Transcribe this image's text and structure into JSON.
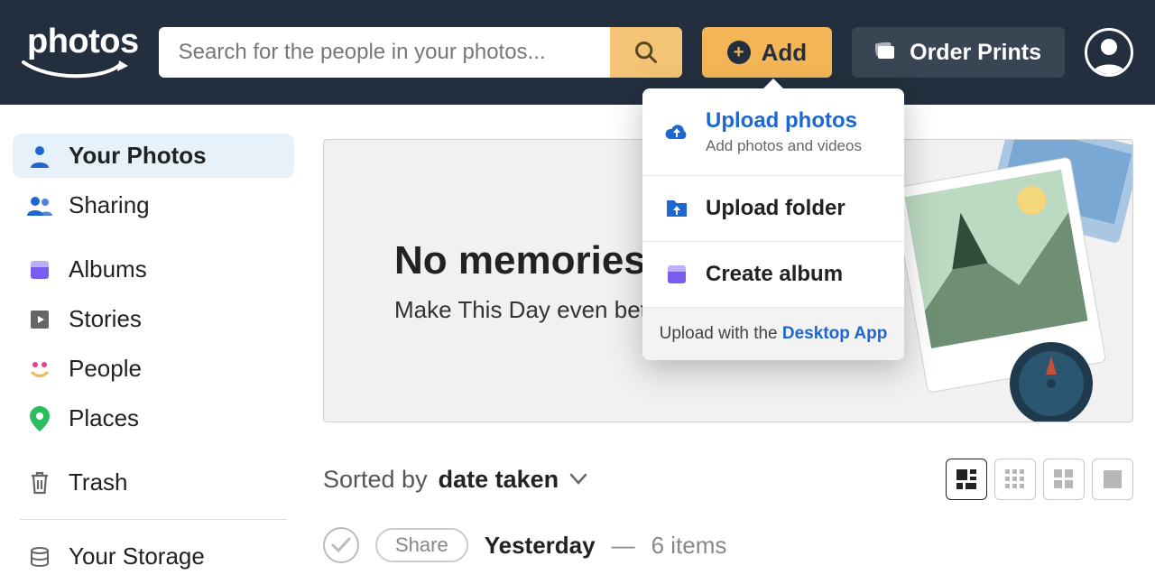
{
  "header": {
    "logo_text": "photos",
    "search_placeholder": "Search for the people in your photos...",
    "add_label": "Add",
    "order_label": "Order Prints"
  },
  "sidebar": {
    "items": [
      {
        "label": "Your Photos",
        "icon": "person-icon",
        "active": true
      },
      {
        "label": "Sharing",
        "icon": "group-icon",
        "active": false
      },
      {
        "label": "Albums",
        "icon": "album-icon",
        "active": false
      },
      {
        "label": "Stories",
        "icon": "play-icon",
        "active": false
      },
      {
        "label": "People",
        "icon": "face-icon",
        "active": false
      },
      {
        "label": "Places",
        "icon": "pin-icon",
        "active": false
      },
      {
        "label": "Trash",
        "icon": "trash-icon",
        "active": false
      }
    ],
    "storage_label": "Your Storage"
  },
  "hero": {
    "title": "No memories today",
    "subtitle": "Make This Day even better!"
  },
  "dropdown": {
    "upload_photos": {
      "title": "Upload photos",
      "subtitle": "Add photos and videos"
    },
    "upload_folder": {
      "title": "Upload folder"
    },
    "create_album": {
      "title": "Create album"
    },
    "footer_prefix": "Upload with the ",
    "footer_link": "Desktop App"
  },
  "sorting": {
    "prefix": "Sorted by ",
    "value": "date taken"
  },
  "group": {
    "share_label": "Share",
    "title": "Yesterday",
    "separator": " — ",
    "count_text": "6 items"
  }
}
